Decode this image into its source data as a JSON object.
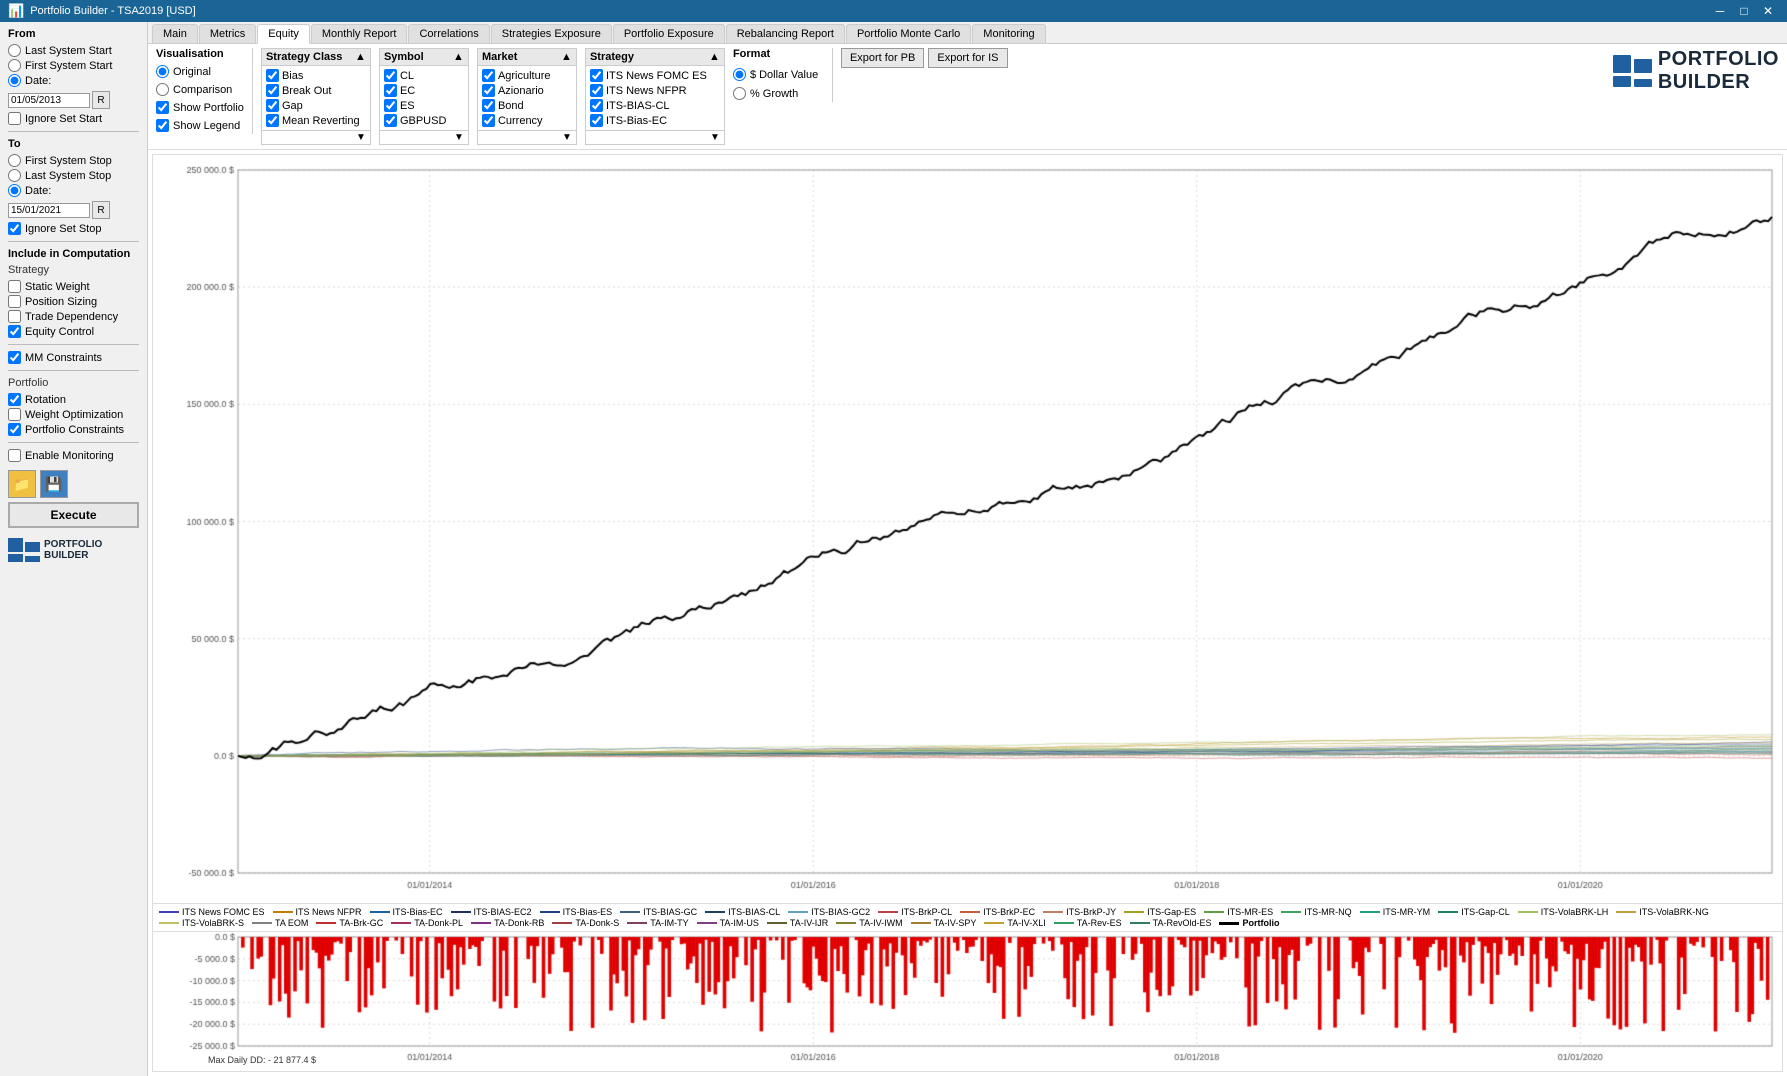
{
  "titlebar": {
    "title": "Portfolio Builder - TSA2019 [USD]",
    "icon": "📊"
  },
  "tabs": [
    {
      "id": "main",
      "label": "Main"
    },
    {
      "id": "metrics",
      "label": "Metrics"
    },
    {
      "id": "equity",
      "label": "Equity",
      "active": true
    },
    {
      "id": "monthly-report",
      "label": "Monthly Report"
    },
    {
      "id": "correlations",
      "label": "Correlations"
    },
    {
      "id": "strategies-exposure",
      "label": "Strategies Exposure"
    },
    {
      "id": "portfolio-exposure",
      "label": "Portfolio Exposure"
    },
    {
      "id": "rebalancing-report",
      "label": "Rebalancing Report"
    },
    {
      "id": "portfolio-monte-carlo",
      "label": "Portfolio Monte Carlo"
    },
    {
      "id": "monitoring",
      "label": "Monitoring"
    }
  ],
  "visualisation": {
    "label": "Visualisation",
    "options": [
      {
        "id": "original",
        "label": "Original",
        "checked": true
      },
      {
        "id": "comparison",
        "label": "Comparison",
        "checked": false
      }
    ],
    "checkboxes": [
      {
        "id": "show-portfolio",
        "label": "Show Portfolio",
        "checked": true
      },
      {
        "id": "show-legend",
        "label": "Show Legend",
        "checked": true
      }
    ]
  },
  "strategy_class": {
    "header": "Strategy Class",
    "items": [
      {
        "label": "Bias",
        "checked": true
      },
      {
        "label": "Break Out",
        "checked": true
      },
      {
        "label": "Gap",
        "checked": true
      },
      {
        "label": "Mean Reverting",
        "checked": true
      }
    ]
  },
  "symbol": {
    "header": "Symbol",
    "items": [
      {
        "label": "CL",
        "checked": true
      },
      {
        "label": "EC",
        "checked": true
      },
      {
        "label": "ES",
        "checked": true
      },
      {
        "label": "GBPUSD",
        "checked": true
      }
    ]
  },
  "market": {
    "header": "Market",
    "items": [
      {
        "label": "Agriculture",
        "checked": true
      },
      {
        "label": "Azionario",
        "checked": true
      },
      {
        "label": "Bond",
        "checked": true
      },
      {
        "label": "Currency",
        "checked": true
      }
    ]
  },
  "strategy": {
    "header": "Strategy",
    "items": [
      {
        "label": "ITS News FOMC ES",
        "checked": true
      },
      {
        "label": "ITS News NFPR",
        "checked": true
      },
      {
        "label": "ITS-BIAS-CL",
        "checked": true
      },
      {
        "label": "ITS-Bias-EC",
        "checked": true
      }
    ]
  },
  "format": {
    "label": "Format",
    "options": [
      {
        "id": "dollar",
        "label": "$ Dollar Value",
        "checked": true
      },
      {
        "id": "growth",
        "label": "% Growth",
        "checked": false
      }
    ]
  },
  "export": {
    "pb_label": "Export for PB",
    "is_label": "Export for IS"
  },
  "from_section": {
    "label": "From",
    "options": [
      {
        "id": "last-system-start",
        "label": "Last System Start",
        "checked": false
      },
      {
        "id": "first-system-start",
        "label": "First System Start",
        "checked": false
      },
      {
        "id": "from-date",
        "label": "Date:",
        "checked": true
      }
    ],
    "date": "01/05/2013",
    "ignore_set_start": {
      "label": "Ignore Set Start",
      "checked": false
    }
  },
  "to_section": {
    "label": "To",
    "options": [
      {
        "id": "first-system-stop",
        "label": "First System Stop",
        "checked": false
      },
      {
        "id": "last-system-stop",
        "label": "Last System Stop",
        "checked": false
      },
      {
        "id": "to-date",
        "label": "Date:",
        "checked": true
      }
    ],
    "date": "15/01/2021",
    "ignore_set_stop": {
      "label": "Ignore Set Stop",
      "checked": true
    }
  },
  "computation": {
    "label": "Include in Computation",
    "strategy_label": "Strategy",
    "items": [
      {
        "label": "Static Weight",
        "checked": false
      },
      {
        "label": "Position Sizing",
        "checked": false
      },
      {
        "label": "Trade Dependency",
        "checked": false
      },
      {
        "label": "Equity Control",
        "checked": true
      }
    ],
    "mm_constraints": {
      "label": "MM Constraints",
      "checked": true
    },
    "portfolio_label": "Portfolio",
    "portfolio_items": [
      {
        "label": "Rotation",
        "checked": true
      },
      {
        "label": "Weight Optimization",
        "checked": false
      },
      {
        "label": "Portfolio Constraints",
        "checked": true
      }
    ]
  },
  "monitoring": {
    "label": "Enable Monitoring",
    "checked": false
  },
  "execute_btn": "Execute",
  "legend": [
    {
      "label": "ITS News FOMC ES",
      "color": "#4040c0"
    },
    {
      "label": "ITS News NFPR",
      "color": "#c08000"
    },
    {
      "label": "ITS-Bias-EC",
      "color": "#2060a0"
    },
    {
      "label": "ITS-BIAS-EC2",
      "color": "#203060"
    },
    {
      "label": "ITS-Bias-ES",
      "color": "#204080"
    },
    {
      "label": "ITS-BIAS-GC",
      "color": "#406080"
    },
    {
      "label": "ITS-BIAS-CL",
      "color": "#204060"
    },
    {
      "label": "ITS-BIAS-GC2",
      "color": "#60a0c0"
    },
    {
      "label": "ITS-BrkP-CL",
      "color": "#c04040"
    },
    {
      "label": "ITS-BrkP-EC",
      "color": "#c06040"
    },
    {
      "label": "ITS-BrkP-JY",
      "color": "#c08060"
    },
    {
      "label": "ITS-Gap-ES",
      "color": "#a0a020"
    },
    {
      "label": "ITS-MR-ES",
      "color": "#60a040"
    },
    {
      "label": "ITS-MR-NQ",
      "color": "#40a060"
    },
    {
      "label": "ITS-MR-YM",
      "color": "#20a080"
    },
    {
      "label": "ITS-Gap-CL",
      "color": "#208060"
    },
    {
      "label": "ITS-VolaBRK-LH",
      "color": "#a0c060"
    },
    {
      "label": "ITS-VolaBRK-NG",
      "color": "#c0a040"
    },
    {
      "label": "ITS-VolaBRK-S",
      "color": "#c0c060"
    },
    {
      "label": "TA EOM",
      "color": "#808080"
    },
    {
      "label": "TA-Brk-GC",
      "color": "#c03030"
    },
    {
      "label": "TA-Donk-PL",
      "color": "#a03060"
    },
    {
      "label": "TA-Donk-RB",
      "color": "#803080"
    },
    {
      "label": "TA-Donk-S",
      "color": "#a04040"
    },
    {
      "label": "TA-IM-TY",
      "color": "#804060"
    },
    {
      "label": "TA-IM-US",
      "color": "#804080"
    },
    {
      "label": "TA-IV-IJR",
      "color": "#606030"
    },
    {
      "label": "TA-IV-IWM",
      "color": "#808030"
    },
    {
      "label": "TA-IV-SPY",
      "color": "#a08030"
    },
    {
      "label": "TA-IV-XLI",
      "color": "#c0a030"
    },
    {
      "label": "TA-Rev-ES",
      "color": "#30a060"
    },
    {
      "label": "TA-RevOld-ES",
      "color": "#308060"
    },
    {
      "label": "Portfolio",
      "color": "#000000",
      "bold": true
    }
  ],
  "dd_label": "Max Daily DD: - 21 877.4 $",
  "y_labels_main": [
    "250 000.0 $",
    "200 000.0 $",
    "150 000.0 $",
    "100 000.0 $",
    "50 000.0 $",
    "0.0 $",
    "-50 000.0 $"
  ],
  "x_labels": [
    "01/01/2014",
    "01/01/2016",
    "01/01/2018",
    "01/01/2020"
  ],
  "y_labels_dd": [
    "0.0 $",
    "-5 000.0 $",
    "-10 000.0 $",
    "-15 000.0 $",
    "-20 000.0 $",
    "-25 000.0 $"
  ]
}
